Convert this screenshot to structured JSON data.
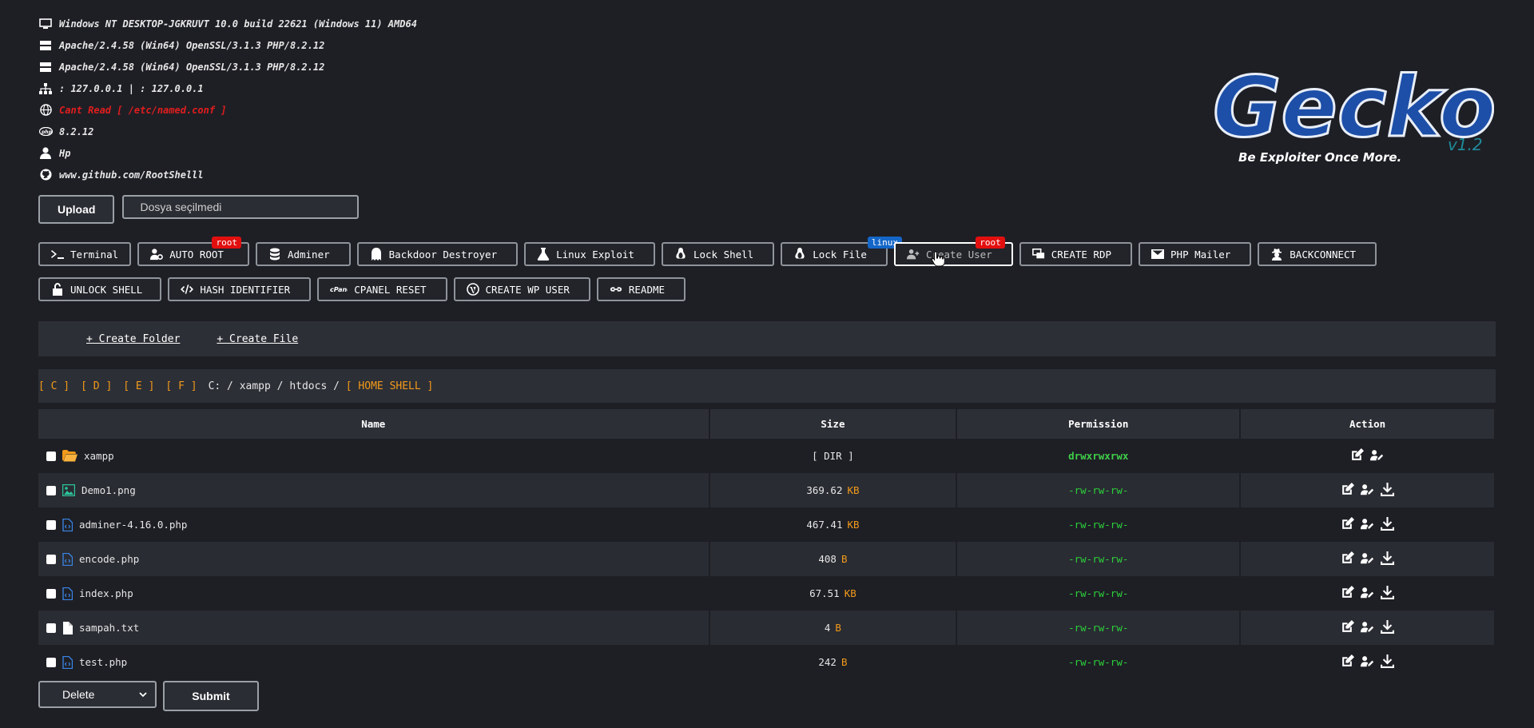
{
  "sysinfo": {
    "os": "Windows NT DESKTOP-JGKRUVT 10.0 build 22621 (Windows 11) AMD64",
    "server1": "Apache/2.4.58 (Win64) OpenSSL/3.1.3 PHP/8.2.12",
    "server2": "Apache/2.4.58 (Win64) OpenSSL/3.1.3 PHP/8.2.12",
    "ip": ": 127.0.0.1 | : 127.0.0.1",
    "named": "Cant Read [ /etc/named.conf ]",
    "php": "8.2.12",
    "user": "Hp",
    "github": "www.github.com/RootShelll"
  },
  "logo": {
    "text": "Gecko",
    "version": "v1.2",
    "tagline": "Be Exploiter Once More."
  },
  "upload": {
    "button": "Upload",
    "file_label": "Dosya seçilmedi"
  },
  "tools": {
    "row1": [
      {
        "label": "Terminal",
        "icon": "terminal-icon"
      },
      {
        "label": "AUTO ROOT",
        "icon": "user-gear-icon",
        "badge": "root"
      },
      {
        "label": "Adminer",
        "icon": "database-icon"
      },
      {
        "label": "Backdoor Destroyer",
        "icon": "ghost-icon"
      },
      {
        "label": "Linux Exploit",
        "icon": "flask-icon"
      },
      {
        "label": "Lock Shell",
        "icon": "linux-icon"
      },
      {
        "label": "Lock File",
        "icon": "linux-icon",
        "badge": "linux"
      },
      {
        "label": "Create User",
        "icon": "user-plus-icon",
        "badge": "root"
      },
      {
        "label": "CREATE RDP",
        "icon": "laptop-icon"
      },
      {
        "label": "PHP Mailer",
        "icon": "envelope-icon"
      },
      {
        "label": "BACKCONNECT",
        "icon": "user-secret-icon"
      }
    ],
    "row2": [
      {
        "label": "UNLOCK SHELL",
        "icon": "unlock-icon"
      },
      {
        "label": "HASH IDENTIFIER",
        "icon": "code-icon"
      },
      {
        "label": "CPANEL RESET",
        "icon": "cpanel-icon"
      },
      {
        "label": "CREATE WP USER",
        "icon": "wordpress-icon"
      },
      {
        "label": "README",
        "icon": "link-icon"
      }
    ]
  },
  "create": {
    "folder": "+ Create Folder",
    "file": "+ Create File"
  },
  "path": {
    "drives": [
      "[ C ]",
      "[ D ]",
      "[ E ]",
      "[ F ]"
    ],
    "segments": [
      "C:",
      "/",
      "xampp",
      "/",
      "htdocs",
      "/"
    ],
    "home": "[ HOME SHELL ]"
  },
  "table": {
    "headers": [
      "Name",
      "Size",
      "Permission",
      "Action"
    ],
    "rows": [
      {
        "name": "xampp",
        "size": "[ DIR ]",
        "unit": "",
        "perm": "drwxrwxrwx",
        "type": "folder"
      },
      {
        "name": "Demo1.png",
        "size": "369.62",
        "unit": "KB",
        "perm": "-rw-rw-rw-",
        "type": "image"
      },
      {
        "name": "adminer-4.16.0.php",
        "size": "467.41",
        "unit": "KB",
        "perm": "-rw-rw-rw-",
        "type": "code"
      },
      {
        "name": "encode.php",
        "size": "408",
        "unit": "B",
        "perm": "-rw-rw-rw-",
        "type": "code"
      },
      {
        "name": "index.php",
        "size": "67.51",
        "unit": "KB",
        "perm": "-rw-rw-rw-",
        "type": "code"
      },
      {
        "name": "sampah.txt",
        "size": "4",
        "unit": "B",
        "perm": "-rw-rw-rw-",
        "type": "text"
      },
      {
        "name": "test.php",
        "size": "242",
        "unit": "B",
        "perm": "-rw-rw-rw-",
        "type": "code"
      }
    ]
  },
  "bottom": {
    "select": "Delete",
    "submit": "Submit"
  },
  "colors": {
    "bg": "#1e1f25",
    "accent": "#f29a1a",
    "perm": "#2bd03a",
    "danger": "#e20f0f",
    "info": "#1466c8"
  }
}
